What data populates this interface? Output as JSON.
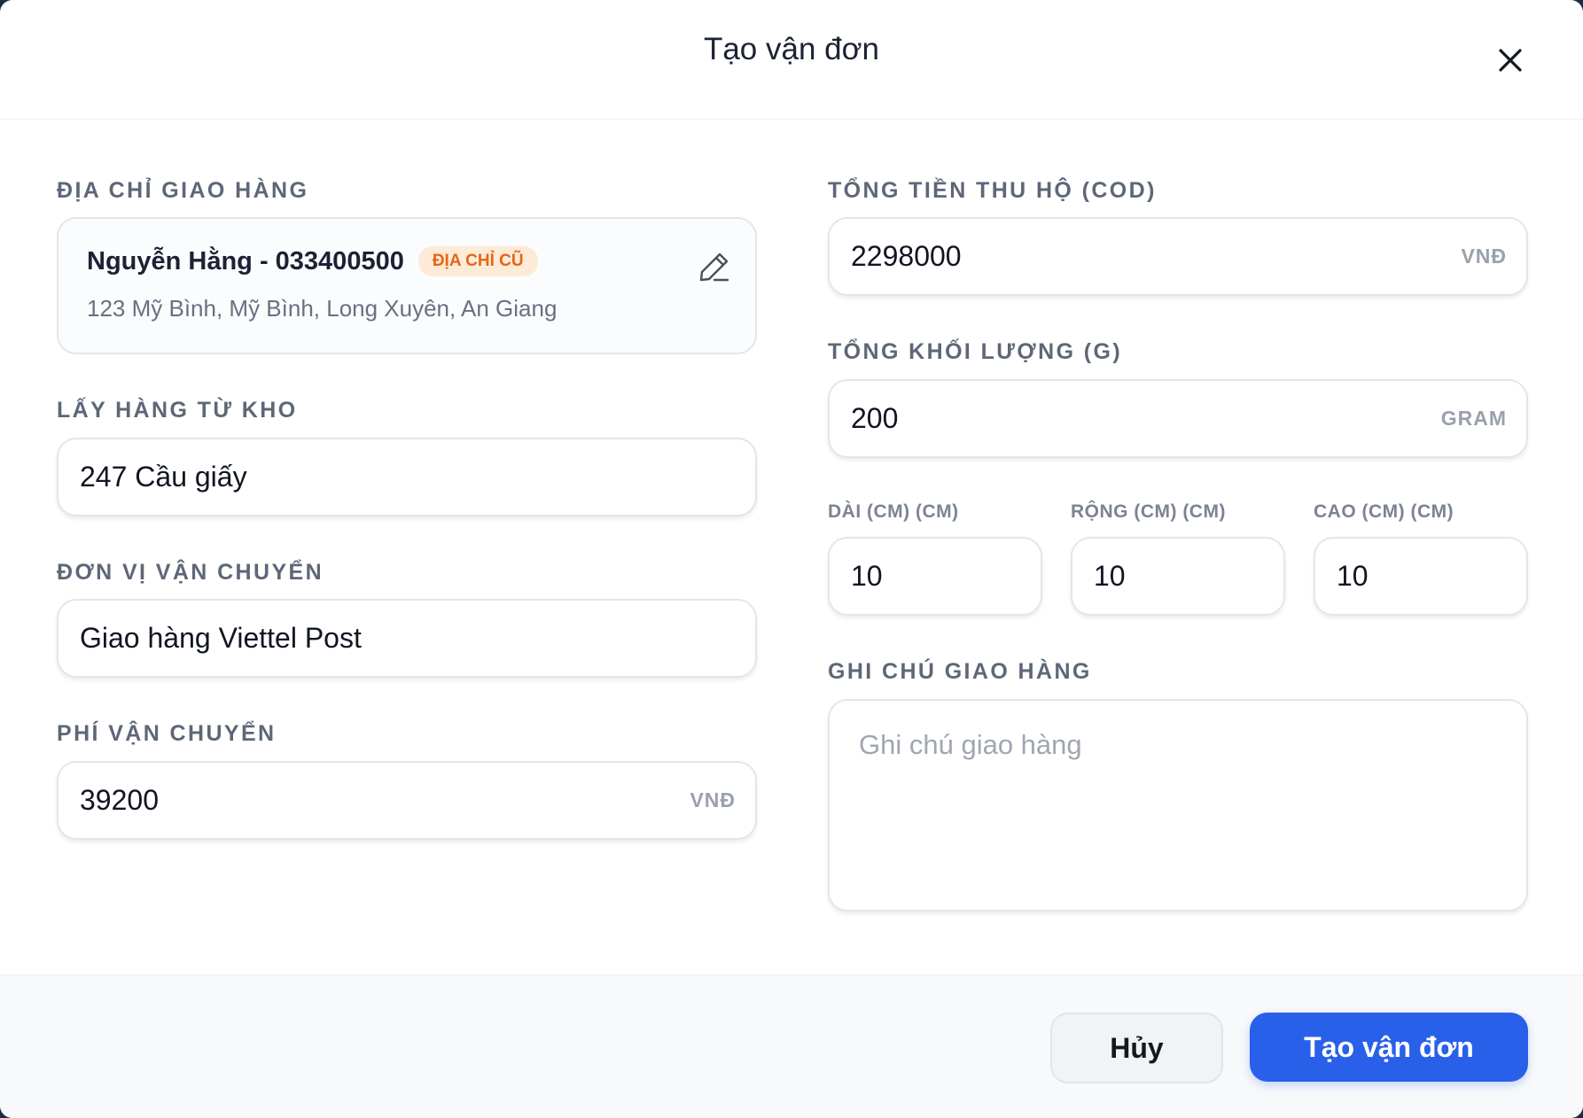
{
  "header": {
    "title": "Tạo vận đơn"
  },
  "left": {
    "address_label": "ĐỊA CHỈ GIAO HÀNG",
    "address": {
      "name_phone": "Nguyễn Hằng - 033400500",
      "badge": "ĐỊA CHỈ CŨ",
      "line": "123 Mỹ Bình, Mỹ Bình, Long Xuyên, An Giang"
    },
    "warehouse_label": "LẤY HÀNG TỪ KHO",
    "warehouse_value": "247 Cầu giấy",
    "carrier_label": "ĐƠN VỊ VẬN CHUYỂN",
    "carrier_value": "Giao hàng Viettel Post",
    "fee_label": "PHÍ VẬN CHUYỂN",
    "fee_value": "39200",
    "fee_unit": "VNĐ"
  },
  "right": {
    "cod_label": "TỔNG TIỀN THU HỘ (COD)",
    "cod_value": "2298000",
    "cod_unit": "VNĐ",
    "weight_label": "TỔNG KHỐI LƯỢNG (G)",
    "weight_value": "200",
    "weight_unit": "GRAM",
    "length_label": "DÀI (CM) (CM)",
    "length_value": "10",
    "width_label": "RỘNG (CM) (CM)",
    "width_value": "10",
    "height_label": "CAO (CM) (CM)",
    "height_value": "10",
    "note_label": "GHI CHÚ GIAO HÀNG",
    "note_placeholder": "Ghi chú giao hàng"
  },
  "footer": {
    "cancel_label": "Hủy",
    "submit_label": "Tạo vận đơn"
  },
  "colors": {
    "primary": "#2860ea",
    "badge_bg": "#fdebd7",
    "badge_text": "#e4661a",
    "label": "#5e6778"
  },
  "icons": {
    "close": "close-icon",
    "edit": "pencil-icon"
  }
}
